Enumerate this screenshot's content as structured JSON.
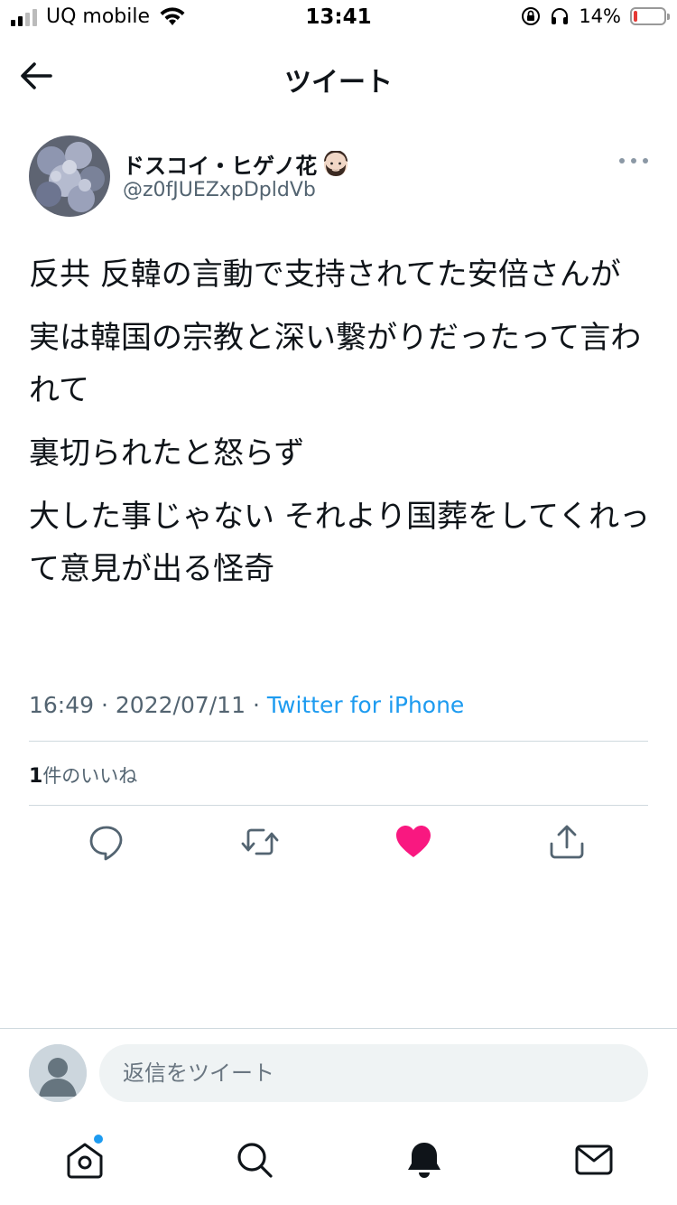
{
  "status_bar": {
    "carrier": "UQ mobile",
    "time": "13:41",
    "battery_percent": "14%",
    "battery_level": 0.14
  },
  "header": {
    "title": "ツイート"
  },
  "tweet": {
    "author_name": "ドスコイ・ヒゲノ花",
    "author_handle": "@z0fJUEZxpDpldVb",
    "paragraphs": [
      "反共 反韓の言動で支持されてた安倍さんが",
      "実は韓国の宗教と深い繋がりだったって言われて",
      "裏切られたと怒らず",
      "大した事じゃない それより国葬をしてくれって意見が出る怪奇"
    ],
    "time": "16:49",
    "separator": "·",
    "date": "2022/07/11",
    "source": "Twitter for iPhone",
    "like_count": "1",
    "like_label": "件のいいね"
  },
  "actions": {
    "reply_icon": "reply-icon",
    "retweet_icon": "retweet-icon",
    "like_icon": "heart-icon",
    "share_icon": "share-icon",
    "like_color": "#f91880"
  },
  "reply": {
    "placeholder": "返信をツイート"
  },
  "tabbar": {
    "icons": [
      "home-icon",
      "search-icon",
      "notifications-icon",
      "messages-icon"
    ],
    "accent": "#1d9bf0"
  }
}
